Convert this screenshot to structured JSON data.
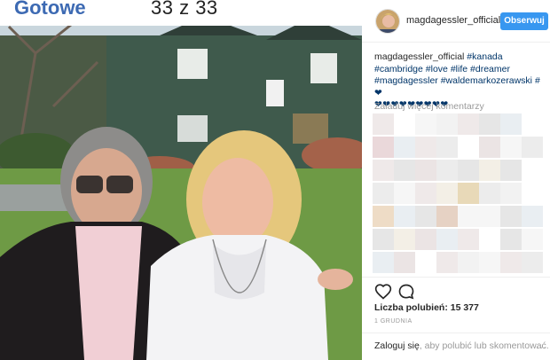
{
  "viewer": {
    "done_label": "Gotowe",
    "counter_text": "33 z 33"
  },
  "post": {
    "username": "magdagessler_official",
    "follow_label": "Obserwuj",
    "caption_user": "magdagessler_official",
    "caption_tags": [
      "#kanada",
      "#cambridge",
      "#love",
      "#life",
      "#dreamer",
      "#magdagessler",
      "#waldemarkozerawski",
      "#"
    ],
    "caption_hearts": "❤❤❤❤❤❤❤❤❤",
    "load_more_comments": "Załaduj więcej komentarzy",
    "likes_text": "Liczba polubień: 15 377",
    "date_text": "1 GRUDNIA",
    "login_link": "Zaloguj się",
    "login_rest": ", aby polubić lub skomentować.",
    "more_dots": "..."
  },
  "colors": {
    "accent_blue": "#3897f0",
    "hashtag": "#003569",
    "done_link": "#3d6ab3"
  }
}
